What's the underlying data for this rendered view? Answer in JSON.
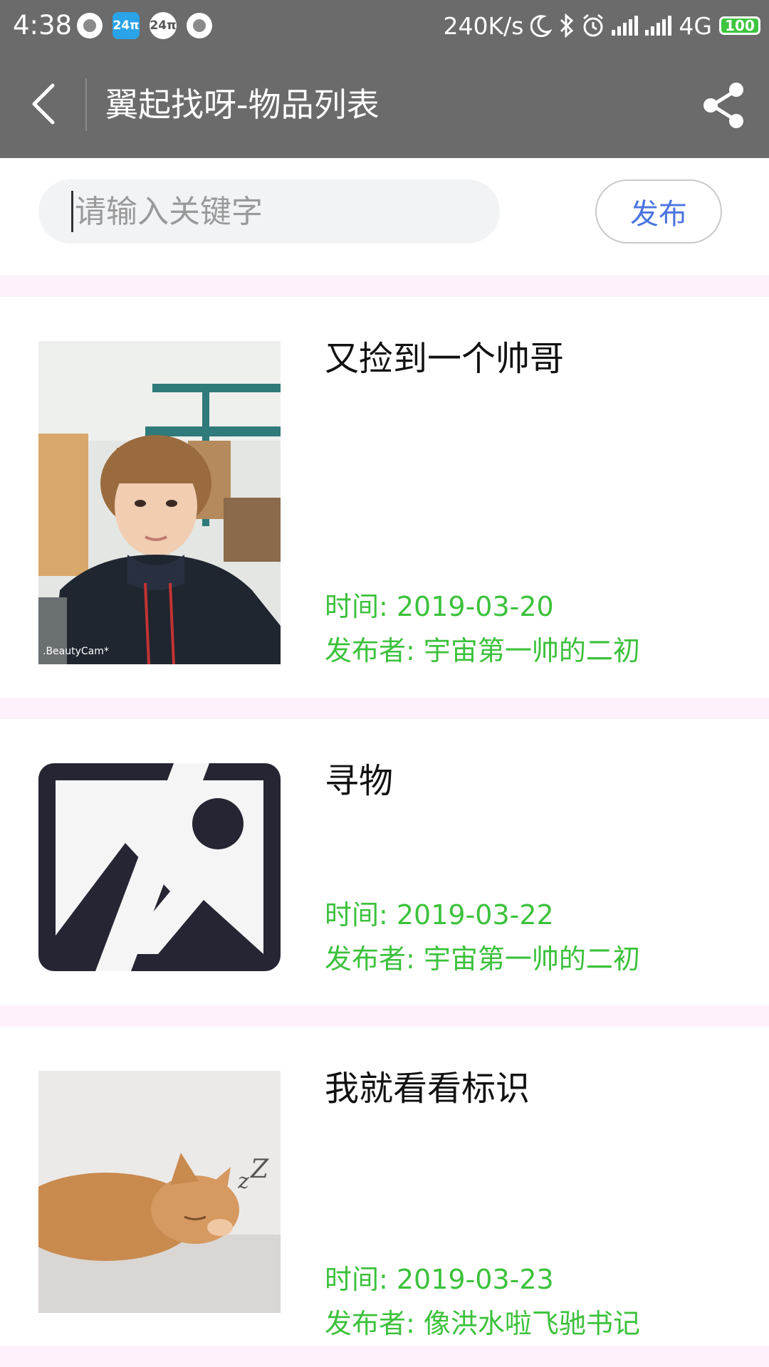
{
  "status_bar": {
    "time": "4:38",
    "net_speed": "240K/s",
    "network": "4G",
    "battery": "100"
  },
  "header": {
    "title": "翼起找呀-物品列表",
    "back_icon": "chevron-left-icon",
    "share_icon": "share-icon"
  },
  "search": {
    "placeholder": "请输入关键字",
    "value": ""
  },
  "publish_label": "发布",
  "colors": {
    "header_bg": "#6b6b6b",
    "accent_blue": "#4a74e0",
    "meta_green": "#3cc13c",
    "separator_pink": "#fdf2fb"
  },
  "items": [
    {
      "title": "又捡到一个帅哥",
      "time": "时间: 2019-03-20",
      "publisher": "发布者: 宇宙第一帅的二初",
      "image": "selfie-photo",
      "watermark": ".BeautyCam*"
    },
    {
      "title": "寻物",
      "time": "时间: 2019-03-22",
      "publisher": "发布者: 宇宙第一帅的二初",
      "image": "image-placeholder-icon"
    },
    {
      "title": "我就看看标识",
      "time": "时间: 2019-03-23",
      "publisher": "发布者: 像洪水啦飞驰书记",
      "image": "sleeping-cat-photo"
    }
  ]
}
